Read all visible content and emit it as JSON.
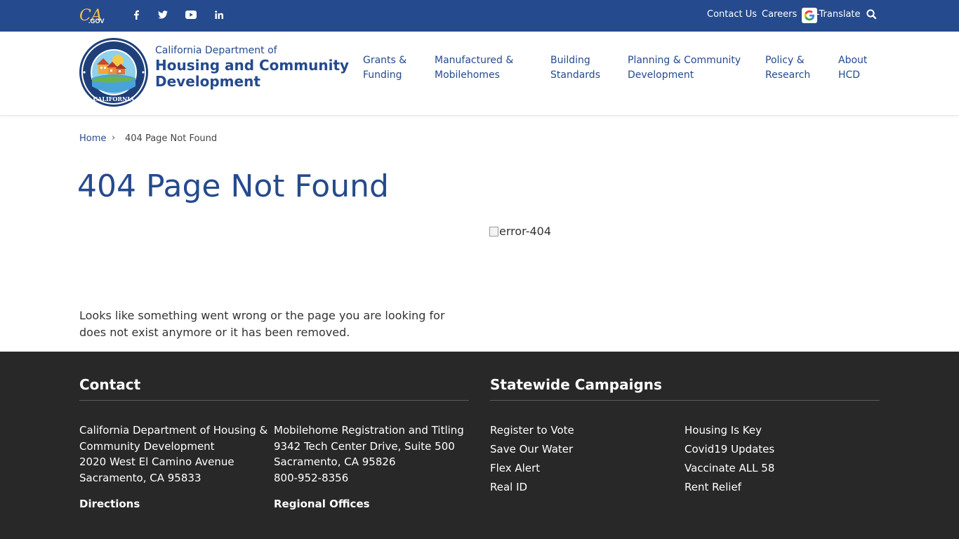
{
  "utility": {
    "logo_text": ".GOV",
    "social_icons": [
      "facebook-icon",
      "twitter-icon",
      "youtube-icon",
      "linkedin-icon"
    ],
    "links": [
      "Contact Us",
      "Careers"
    ],
    "translate_label": "-Translate"
  },
  "header": {
    "brand_sub": "California Department of",
    "brand_main": "Housing and Community Development",
    "nav": [
      {
        "line1": "Grants &",
        "line2": "Funding"
      },
      {
        "line1": "Manufactured &",
        "line2": "Mobilehomes"
      },
      {
        "line1": "Building",
        "line2": "Standards"
      },
      {
        "line1": "Planning & Community",
        "line2": "Development"
      },
      {
        "line1": "Policy &",
        "line2": "Research"
      },
      {
        "line1": "About",
        "line2": "HCD"
      }
    ]
  },
  "breadcrumb": {
    "home": "Home",
    "separator": "›",
    "current": "404 Page Not Found"
  },
  "main": {
    "title": "404 Page Not Found",
    "image_alt": "error-404",
    "message": "Looks like something went wrong or the page you are looking for does not exist anymore or it has been removed."
  },
  "footer": {
    "contact": {
      "heading": "Contact",
      "col1": [
        "California Department of Housing &",
        "Community Development",
        "2020 West El Camino Avenue",
        "Sacramento, CA 95833"
      ],
      "col1_link": "Directions",
      "col2": [
        "Mobilehome Registration and Titling",
        "9342 Tech Center Drive, Suite 500",
        "Sacramento, CA 95826",
        "800-952-8356"
      ],
      "col2_link": "Regional Offices"
    },
    "campaigns": {
      "heading": "Statewide Campaigns",
      "col1": [
        "Register to Vote",
        "Save Our Water",
        "Flex Alert",
        "Real ID"
      ],
      "col2": [
        "Housing Is Key",
        "Covid19 Updates",
        "Vaccinate ALL 58",
        "Rent Relief"
      ]
    }
  },
  "colors": {
    "brand_blue": "#254a8d",
    "footer_bg": "#282828"
  }
}
